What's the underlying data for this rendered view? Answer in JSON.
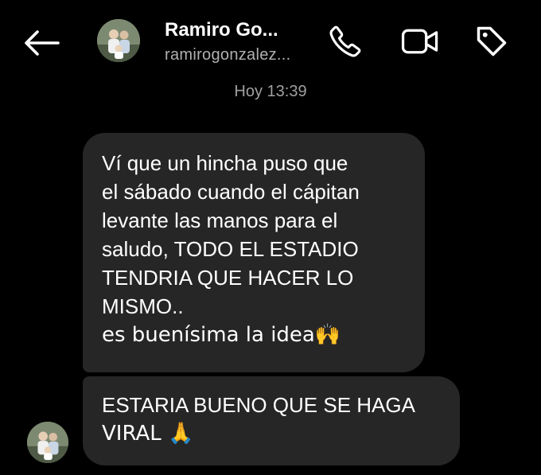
{
  "header": {
    "contact_name": "Ramiro Go...",
    "contact_handle": "ramirogonzalez...",
    "icons": {
      "back": "back-arrow-icon",
      "call": "phone-icon",
      "video": "video-camera-icon",
      "tag": "tag-icon"
    }
  },
  "thread": {
    "timestamp": "Hoy 13:39",
    "messages": [
      {
        "lines": [
          "Ví que un hincha puso que",
          "el sábado cuando el cápitan",
          "levante las manos para el",
          "saludo, TODO EL ESTADIO",
          "TENDRIA QUE HACER LO",
          "MISMO..",
          "es buenísima la idea🙌"
        ]
      },
      {
        "lines": [
          "ESTARIA BUENO QUE SE HAGA",
          "VIRAL 🙏"
        ]
      }
    ]
  },
  "colors": {
    "background": "#000000",
    "bubble": "#262626",
    "secondary_text": "#a0a0a0"
  }
}
